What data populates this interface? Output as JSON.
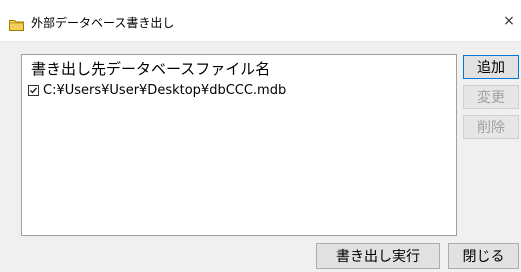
{
  "window": {
    "title": "外部データベース書き出し",
    "close_glyph": "×",
    "title_icon": "folder-icon",
    "folder_color": "#e8c547"
  },
  "list": {
    "header": "書き出し先データベースファイル名",
    "items": [
      {
        "checked": true,
        "label": "C:¥Users¥User¥Desktop¥dbCCC.mdb"
      }
    ]
  },
  "side_buttons": {
    "add_label": "追加",
    "change_label": "変更",
    "delete_label": "削除"
  },
  "bottom_buttons": {
    "export_label": "書き出し実行",
    "close_label": "閉じる"
  },
  "colors": {
    "focus_border": "#0078d7",
    "disabled_text": "#a0a0a0"
  }
}
